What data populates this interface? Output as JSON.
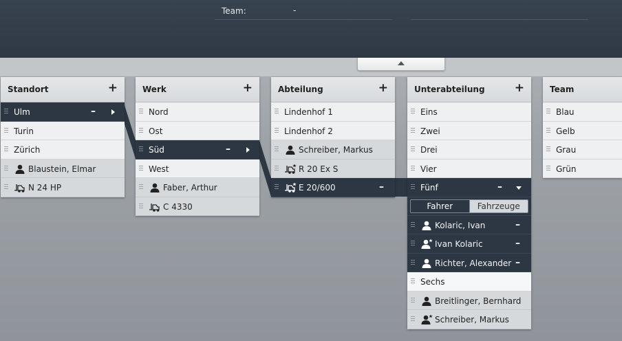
{
  "header": {
    "team_label": "Team:",
    "team_value": "-"
  },
  "collapse_tab_icon": "caret-up-icon",
  "colors": {
    "dark": "#2d3743",
    "light_row": "#eef0f1",
    "member_row": "#d6d9dc"
  },
  "columns": {
    "standort": {
      "title": "Standort",
      "add": "+",
      "items": [
        "Ulm",
        "Turin",
        "Zürich"
      ],
      "members": [
        "Blaustein, Elmar",
        "N 24 HP"
      ],
      "selected_controls": {
        "minus": "–"
      }
    },
    "werk": {
      "title": "Werk",
      "add": "+",
      "items": [
        "Nord",
        "Ost",
        "Süd",
        "West"
      ],
      "members": [
        "Faber, Arthur",
        "C 4330"
      ],
      "selected_controls": {
        "minus": "–"
      }
    },
    "abteilung": {
      "title": "Abteilung",
      "add": "+",
      "items": [
        "Lindenhof 1",
        "Lindenhof 2"
      ],
      "members": [
        "Schreiber, Markus",
        "R 20 Ex S",
        "E 20/600"
      ],
      "selected_controls": {
        "minus": "–"
      }
    },
    "unterabteilung": {
      "title": "Unterabteilung",
      "add": "+",
      "items": [
        "Eins",
        "Zwei",
        "Drei",
        "Vier",
        "Fünf",
        "Sechs"
      ],
      "selected_controls": {
        "minus": "–"
      },
      "toggle": {
        "drivers": "Fahrer",
        "vehicles": "Fahrzeuge"
      },
      "assigned_drivers": [
        "Kolaric, Ivan",
        "Ivan Kolaric",
        "Richter, Alexander"
      ],
      "members": [
        "Breitlinger, Bernhard",
        "Schreiber, Markus"
      ]
    },
    "team": {
      "title": "Team",
      "items": [
        "Blau",
        "Gelb",
        "Grau",
        "Grün"
      ]
    }
  }
}
